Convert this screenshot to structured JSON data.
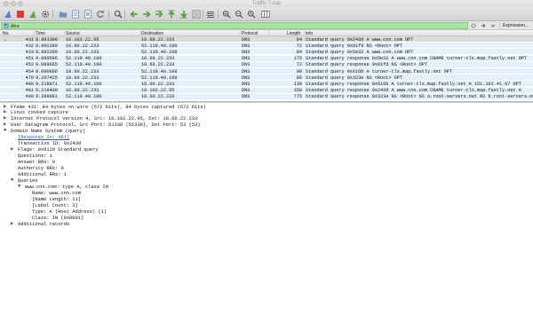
{
  "window": {
    "title": "Traffic 7.cap"
  },
  "toolbar": {
    "buttons": [
      {
        "name": "start-capture-icon",
        "icon": "shark-fin",
        "color": "#4a7fd9"
      },
      {
        "name": "stop-capture-icon",
        "icon": "stop-square",
        "color": "#d93a2f"
      },
      {
        "name": "restart-capture-icon",
        "icon": "restart-fin",
        "color": "#5aa844"
      },
      {
        "name": "capture-options-icon",
        "icon": "gear",
        "color": "#555555"
      },
      {
        "name": "open-file-icon",
        "icon": "folder",
        "color": "#6a8fc9"
      },
      {
        "name": "save-file-icon",
        "icon": "document-grid",
        "color": "#6a8fc9"
      },
      {
        "name": "close-file-icon",
        "icon": "document-x",
        "color": "#6a8fc9"
      },
      {
        "name": "reload-file-icon",
        "icon": "reload",
        "color": "#555555"
      },
      {
        "name": "find-packet-icon",
        "icon": "magnifier",
        "color": "#444444"
      },
      {
        "name": "go-back-icon",
        "icon": "arrow-left",
        "color": "#4f9a3a"
      },
      {
        "name": "go-forward-icon",
        "icon": "arrow-right",
        "color": "#4f9a3a"
      },
      {
        "name": "go-to-packet-icon",
        "icon": "arrow-jump",
        "color": "#4f9a3a"
      },
      {
        "name": "go-first-packet-icon",
        "icon": "arrow-top",
        "color": "#4f9a3a"
      },
      {
        "name": "go-last-packet-icon",
        "icon": "arrow-bottom",
        "color": "#4f9a3a"
      },
      {
        "name": "autoscroll-icon",
        "icon": "autoscroll",
        "color": "#555555"
      },
      {
        "name": "colorize-icon",
        "icon": "lines",
        "color": "#555555"
      },
      {
        "name": "zoom-in-icon",
        "icon": "zoom-in",
        "color": "#444444"
      },
      {
        "name": "zoom-out-icon",
        "icon": "zoom-out",
        "color": "#444444"
      },
      {
        "name": "zoom-normal-icon",
        "icon": "zoom-normal",
        "color": "#444444"
      },
      {
        "name": "resize-columns-icon",
        "icon": "columns",
        "color": "#555555"
      }
    ]
  },
  "filter": {
    "value": "dns",
    "background": "#a9e4a1",
    "clear_icon": "x-icon",
    "apply_icon": "arrow-right-icon",
    "dropdown_icon": "chevron-down-icon",
    "expression_label": "Expression..."
  },
  "packet_list": {
    "columns": {
      "no": "No.",
      "time": "Time",
      "source": "Source",
      "destination": "Destination",
      "protocol": "Protocol",
      "length": "Length",
      "info": "Info"
    },
    "selected_marker": "→",
    "rows": [
      {
        "no": "431",
        "time": "8.991309",
        "source": "10.102.22.95",
        "destination": "10.60.22.233",
        "protocol": "DNS",
        "length": "84",
        "info": "Standard query 0x243d A www.cnn.com OPT",
        "selected": true
      },
      {
        "no": "432",
        "time": "8.992280",
        "source": "10.60.22.233",
        "destination": "52.119.40.100",
        "protocol": "DNS",
        "length": "72",
        "info": "Standard query 0x01fd NS <Root> OPT",
        "selected": false
      },
      {
        "no": "433",
        "time": "8.992280",
        "source": "10.60.22.233",
        "destination": "52.119.40.100",
        "protocol": "DNS",
        "length": "84",
        "info": "Standard query 0x5e32 A www.cnn.com OPT",
        "selected": false
      },
      {
        "no": "451",
        "time": "9.089596",
        "source": "52.119.40.100",
        "destination": "10.60.22.233",
        "protocol": "DNS",
        "length": "175",
        "info": "Standard query response 0x5e32 A www.cnn.com CNAME turner-tls.map.fastly.net OPT",
        "selected": false
      },
      {
        "no": "452",
        "time": "9.089665",
        "source": "52.119.40.100",
        "destination": "10.60.22.233",
        "protocol": "DNS",
        "length": "72",
        "info": "Standard query response 0x01fd NS <Root> OPT",
        "selected": false
      },
      {
        "no": "454",
        "time": "9.090896",
        "source": "10.60.22.233",
        "destination": "52.119.40.100",
        "protocol": "DNS",
        "length": "98",
        "info": "Standard query 0x616b A turner-tls.map.fastly.net OPT",
        "selected": false
      },
      {
        "no": "479",
        "time": "9.207425",
        "source": "10.60.22.233",
        "destination": "52.119.40.100",
        "protocol": "DNS",
        "length": "86",
        "info": "Standard query 0x323e NS <Root> OPT",
        "selected": false
      },
      {
        "no": "480",
        "time": "9.218871",
        "source": "52.119.40.100",
        "destination": "10.60.22.233",
        "protocol": "DNS",
        "length": "139",
        "info": "Standard query response 0x616b A turner-tls.map.fastly.net A 151.101.41.67 OPT",
        "selected": false
      },
      {
        "no": "481",
        "time": "9.218400",
        "source": "10.60.22.233",
        "destination": "10.102.22.95",
        "protocol": "DNS",
        "length": "150",
        "info": "Standard query response 0x243d A www.cnn.com CNAME turner-tls.map.fastly.net A",
        "selected": false
      },
      {
        "no": "490",
        "time": "9.398981",
        "source": "52.119.40.100",
        "destination": "10.60.22.233",
        "protocol": "DNS",
        "length": "775",
        "info": "Standard query response 0x323e NS <Root> NS a.root-servers.net NS b.root-servers.net",
        "selected": false
      }
    ]
  },
  "details": {
    "rows": [
      {
        "indent": 0,
        "toggle": "collapsed",
        "text": "Frame 431: 84 bytes on wire (672 bits), 84 bytes captured (672 bits)",
        "link": false
      },
      {
        "indent": 0,
        "toggle": "collapsed",
        "text": "Linux cooked capture",
        "link": false
      },
      {
        "indent": 0,
        "toggle": "collapsed",
        "text": "Internet Protocol Version 4, Src: 10.102.22.95, Dst: 10.60.22.233",
        "link": false
      },
      {
        "indent": 0,
        "toggle": "collapsed",
        "text": "User Datagram Protocol, Src Port: 51338 (51338), Dst Port: 53 (53)",
        "link": false
      },
      {
        "indent": 0,
        "toggle": "expanded",
        "text": "Domain Name System (query)",
        "link": false
      },
      {
        "indent": 1,
        "toggle": "none",
        "text": "[Response In: 481]",
        "link": true
      },
      {
        "indent": 1,
        "toggle": "none",
        "text": "Transaction ID: 0x243d",
        "link": false
      },
      {
        "indent": 1,
        "toggle": "collapsed",
        "text": "Flags: 0x0120 Standard query",
        "link": false
      },
      {
        "indent": 1,
        "toggle": "none",
        "text": "Questions: 1",
        "link": false
      },
      {
        "indent": 1,
        "toggle": "none",
        "text": "Answer RRs: 0",
        "link": false
      },
      {
        "indent": 1,
        "toggle": "none",
        "text": "Authority RRs: 0",
        "link": false
      },
      {
        "indent": 1,
        "toggle": "none",
        "text": "Additional RRs: 1",
        "link": false
      },
      {
        "indent": 1,
        "toggle": "expanded",
        "text": "Queries",
        "link": false
      },
      {
        "indent": 2,
        "toggle": "expanded",
        "text": "www.cnn.com: type A, class IN",
        "link": false
      },
      {
        "indent": 3,
        "toggle": "none",
        "text": "Name: www.cnn.com",
        "link": false
      },
      {
        "indent": 3,
        "toggle": "none",
        "text": "[Name Length: 11]",
        "link": false
      },
      {
        "indent": 3,
        "toggle": "none",
        "text": "[Label Count: 3]",
        "link": false
      },
      {
        "indent": 3,
        "toggle": "none",
        "text": "Type: A (Host Address) (1)",
        "link": false
      },
      {
        "indent": 3,
        "toggle": "none",
        "text": "Class: IN (0x0001)",
        "link": false
      },
      {
        "indent": 1,
        "toggle": "collapsed",
        "text": "Additional records",
        "link": false
      }
    ]
  }
}
